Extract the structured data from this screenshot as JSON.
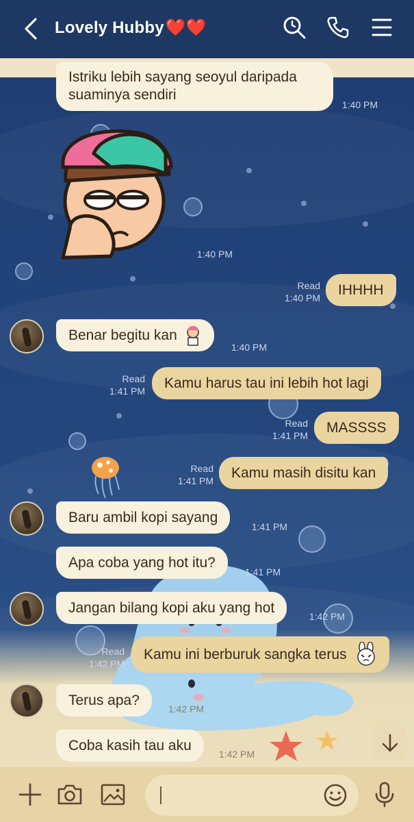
{
  "header": {
    "title": "Lovely Hubby",
    "hearts": "❤️❤️",
    "icons": [
      "back-icon",
      "search-icon",
      "phone-icon",
      "menu-icon"
    ]
  },
  "messages": [
    {
      "side": "in",
      "text": "Istriku lebih sayang seoyul daripada suaminya sendiri",
      "time": "1:40 PM"
    },
    {
      "side": "in",
      "type": "sticker",
      "time": "1:40 PM"
    },
    {
      "side": "out",
      "text": "IHHHH",
      "read": "Read",
      "time": "1:40 PM"
    },
    {
      "side": "in",
      "text": "Benar begitu kan",
      "time": "1:40 PM"
    },
    {
      "side": "out",
      "text": "Kamu harus tau ini lebih hot lagi",
      "read": "Read",
      "time": "1:41 PM"
    },
    {
      "side": "out",
      "text": "MASSSS",
      "read": "Read",
      "time": "1:41 PM"
    },
    {
      "side": "out",
      "text": "Kamu masih disitu kan",
      "read": "Read",
      "time": "1:41 PM"
    },
    {
      "side": "in",
      "text": "Baru ambil kopi sayang",
      "time": "1:41 PM"
    },
    {
      "side": "in",
      "text": "Apa coba yang hot itu?",
      "time": "1:41 PM"
    },
    {
      "side": "in",
      "text": "Jangan bilang kopi aku yang hot",
      "time": "1:42 PM"
    },
    {
      "side": "out",
      "text": "Kamu ini berburuk sangka terus",
      "read": "Read",
      "time": "1:42 PM"
    },
    {
      "side": "in",
      "text": "Terus apa?",
      "time": "1:42 PM"
    },
    {
      "side": "in",
      "text": "Coba kasih tau aku",
      "time": "1:42 PM"
    }
  ],
  "footer": {
    "icons": [
      "plus-icon",
      "camera-icon",
      "image-icon",
      "emoji-icon",
      "mic-icon"
    ],
    "input_value": ""
  },
  "colors": {
    "header_bg": "#1c3863",
    "incoming_bubble": "#f8f1dd",
    "outgoing_bubble": "#ead4a0",
    "footer_bg": "#e6d3a6"
  }
}
